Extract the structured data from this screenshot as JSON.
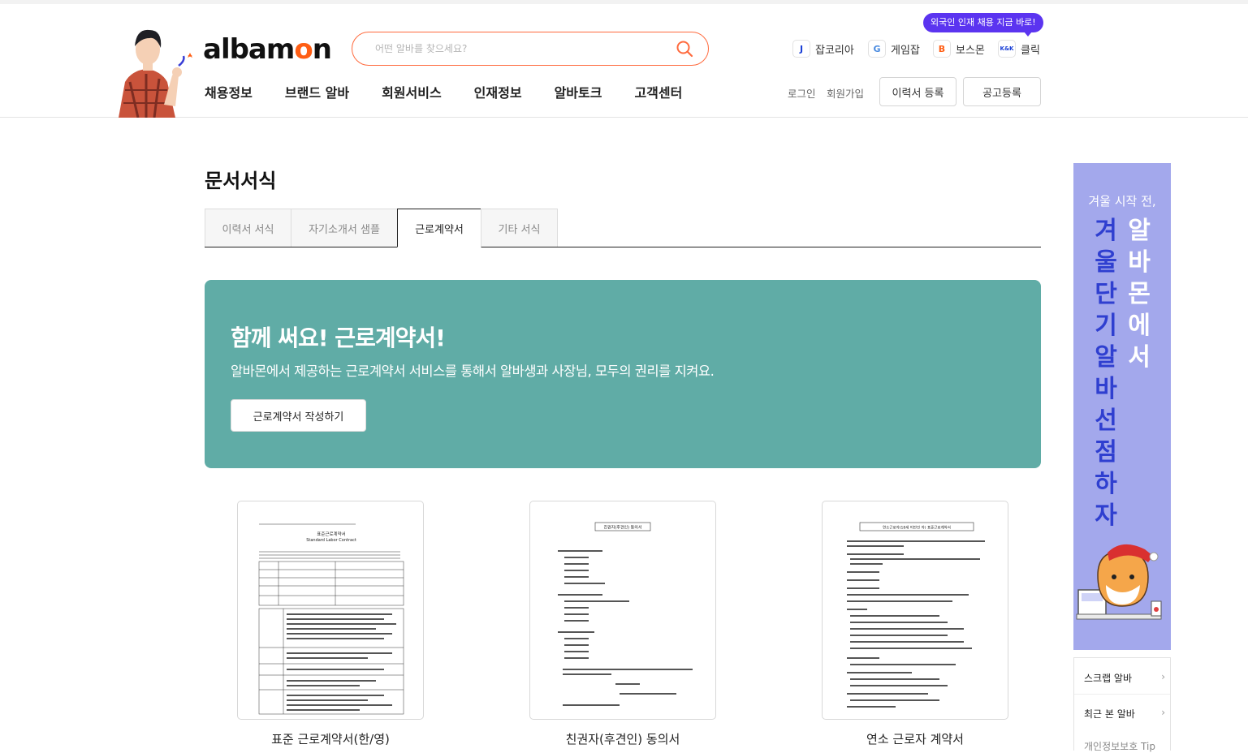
{
  "header": {
    "logo_text_pre": "alba",
    "logo_text_o": "m",
    "logo_text_post": "n",
    "search_placeholder": "어떤 알바를 찾으세요?",
    "foreign_badge": "외국인 인재 채용 지금 바로!",
    "family_sites": [
      {
        "icon_text": "J",
        "label": "잡코리아",
        "icon_color": "#1a3fd6"
      },
      {
        "icon_text": "G",
        "label": "게임잡",
        "icon_color": "#4a8be0"
      },
      {
        "icon_text": "B",
        "label": "보스몬",
        "icon_color": "#ff5e14"
      },
      {
        "icon_text": "K&K",
        "label": "클릭",
        "icon_color": "#1a3fd6"
      }
    ],
    "gnb": [
      "채용정보",
      "브랜드 알바",
      "회원서비스",
      "인재정보",
      "알바토크",
      "고객센터"
    ],
    "login": "로그인",
    "signup": "회원가입",
    "resume_button": "이력서 등록",
    "post_button": "공고등록"
  },
  "main": {
    "title": "문서서식",
    "tabs": [
      "이력서 서식",
      "자기소개서 샘플",
      "근로계약서",
      "기타 서식"
    ],
    "active_tab": "근로계약서",
    "banner": {
      "title": "함께 써요! 근로계약서!",
      "description": "알바몬에서 제공하는 근로계약서 서비스를 통해서 알바생과 사장님, 모두의 권리를 지켜요.",
      "cta": "근로계약서 작성하기",
      "background": "#60aca6"
    },
    "documents": [
      {
        "label": "표준 근로계약서(한/영)",
        "thumb_title": "표준근로계약서",
        "thumb_subtitle": "Standard Labor Contract"
      },
      {
        "label": "친권자(후견인) 동의서",
        "thumb_title": "친권자(후견인) 동의서"
      },
      {
        "label": "연소 근로자 계약서",
        "thumb_title": "연소근로자(18세 미만인 자) 표준근로계약서"
      }
    ]
  },
  "side_ad": {
    "subtitle": "겨울 시작 전,",
    "col_left": [
      "겨",
      "울",
      "단",
      "기",
      "알",
      "바",
      "선",
      "점",
      "하",
      "자"
    ],
    "col_right": [
      "알",
      "바",
      "몬",
      "에",
      "서"
    ],
    "colors": {
      "background": "#a3a8ec",
      "left_text": "#2f3fd0",
      "right_text": "#ffffff"
    }
  },
  "quick_menu": {
    "items": [
      "스크랩 알바",
      "최근 본 알바"
    ],
    "tip": "개인정보보호 Tip"
  }
}
